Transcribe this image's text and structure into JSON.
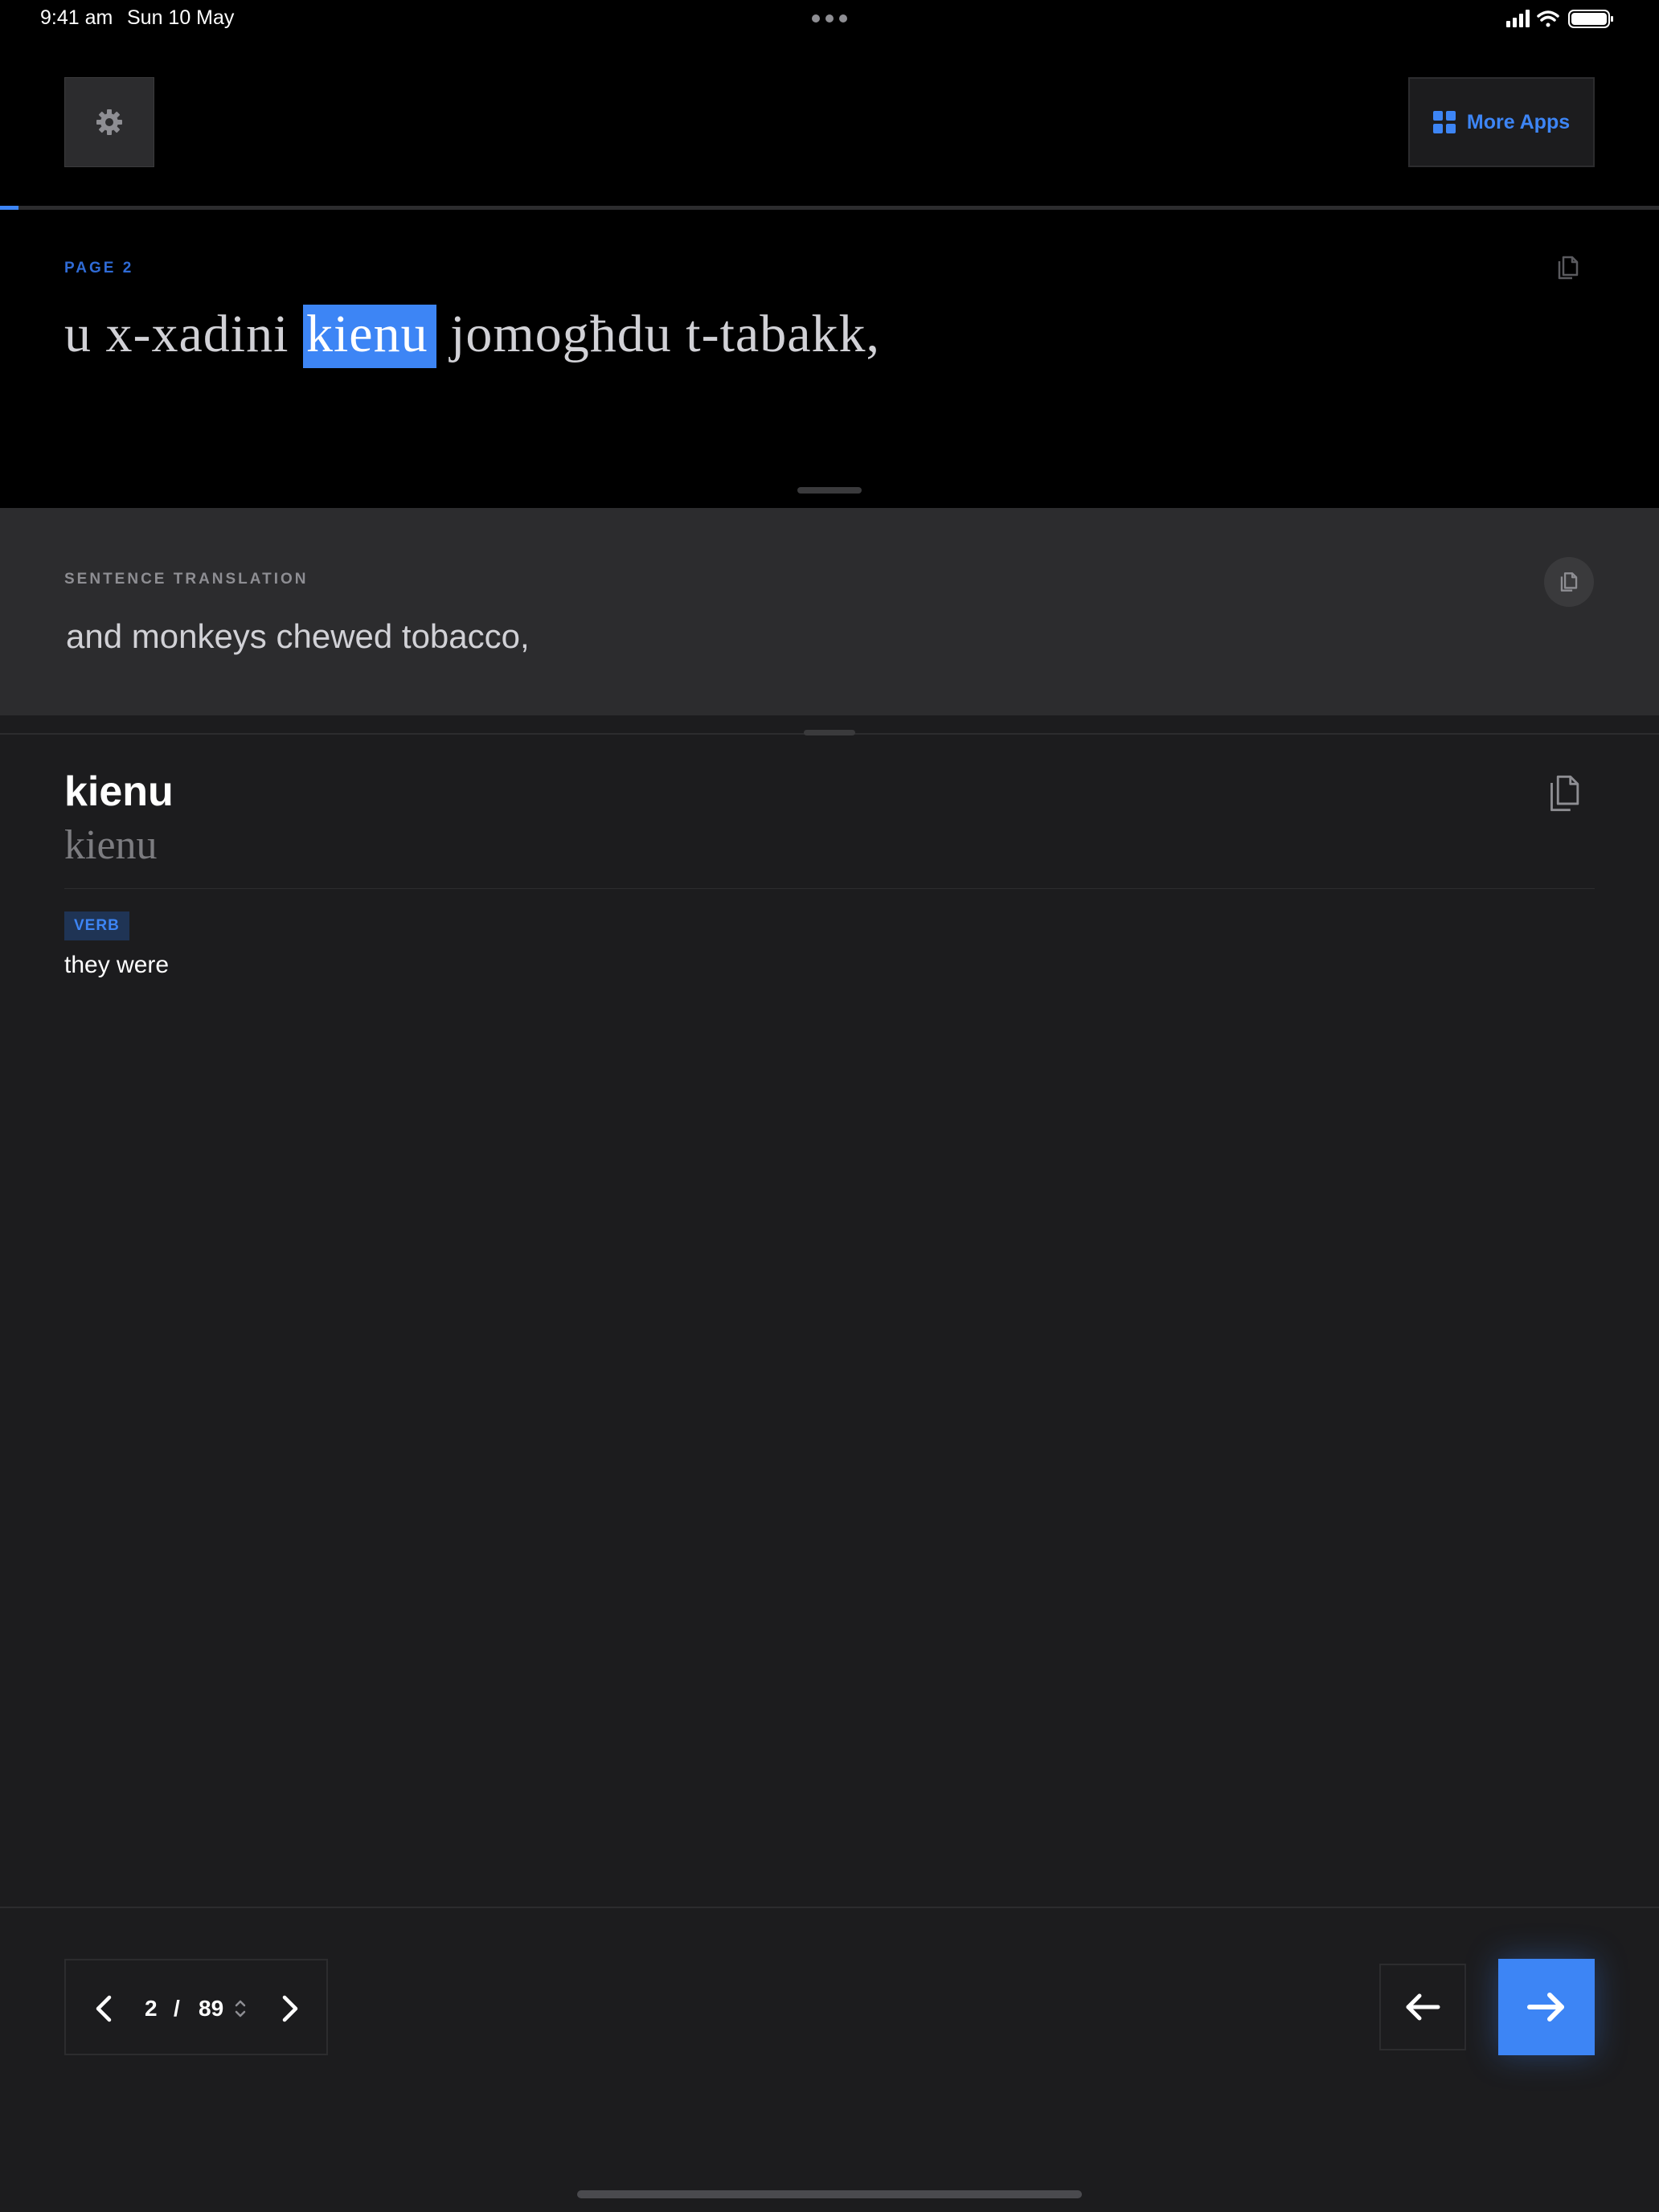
{
  "status_bar": {
    "time": "9:41 am",
    "date": "Sun 10 May",
    "icons": [
      "signal-icon",
      "wifi-icon",
      "battery-icon"
    ]
  },
  "header": {
    "settings_icon": "gear-icon",
    "more_apps_label": "More Apps",
    "more_apps_icon": "grid-icon",
    "progress_fraction": 0.011
  },
  "reader": {
    "page_label": "PAGE  2",
    "sentence_words": [
      "u",
      "x-xadini",
      "kienu",
      "jomogħdu",
      "t-tabakk,"
    ],
    "selected_word_index": 2
  },
  "translation": {
    "label": "SENTENCE TRANSLATION",
    "text": "and monkeys chewed tobacco,"
  },
  "word_detail": {
    "word": "kienu",
    "word_serif": "kienu",
    "part_of_speech": "VERB",
    "meaning": "they were"
  },
  "pager": {
    "current": "2",
    "separator": "/",
    "total": "89"
  },
  "colors": {
    "accent": "#3d85f5",
    "background": "#1c1c1e",
    "panel": "#2c2c2e",
    "top": "#000000"
  }
}
